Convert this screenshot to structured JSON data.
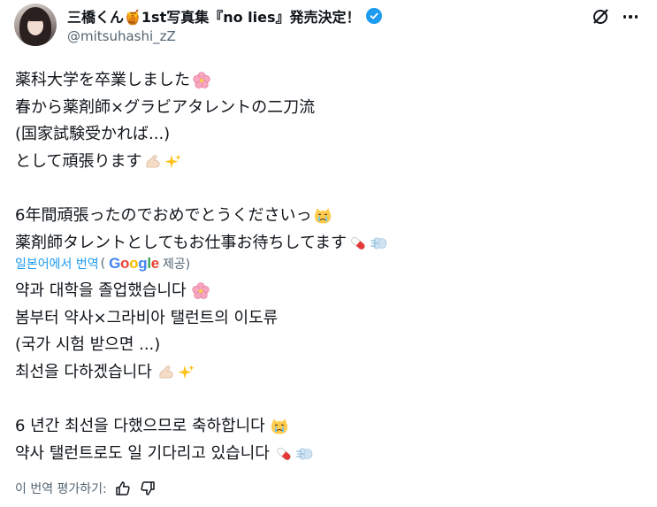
{
  "author": {
    "display_name": "三橋くん🍯1st写真集『no lies』発売決定！",
    "handle": "@mitsuhashi_zZ"
  },
  "tweet": {
    "jp_lines": [
      "薬科大学を卒業しました",
      "春から薬剤師×グラビアタレントの二刀流",
      "(国家試験受かれば...)",
      "として頑張ります",
      "",
      "6年間頑張ったのでおめでとうくださいっ",
      "薬剤師タレントとしてもお仕事お待ちしてます"
    ]
  },
  "translation": {
    "link_text": "일본어에서 번역",
    "paren_open": "(",
    "google": "Google",
    "provided": "제공)",
    "ko_lines": [
      "약과 대학을 졸업했습니다",
      "봄부터 약사×그라비아 탤런트의 이도류",
      "(국가 시험 받으면 ...)",
      "최선을 다하겠습니다",
      "",
      "6 년간 최선을 다했으므로 축하합니다",
      "약사 탤런트로도 일 기다리고 있습니다"
    ]
  },
  "rating": {
    "label": "이 번역 평가하기:"
  },
  "icons": [
    "avatar",
    "honey-pot-icon",
    "verified-badge-icon",
    "grok-icon",
    "more-icon",
    "cherry-blossom-icon",
    "flexed-arm-icon",
    "sparkles-icon",
    "crying-cat-icon",
    "pill-icon",
    "dash-icon",
    "thumbs-up-icon",
    "thumbs-down-icon"
  ],
  "colors": {
    "accent": "#1d9bf0",
    "text": "#0f1419",
    "secondary": "#536471"
  }
}
